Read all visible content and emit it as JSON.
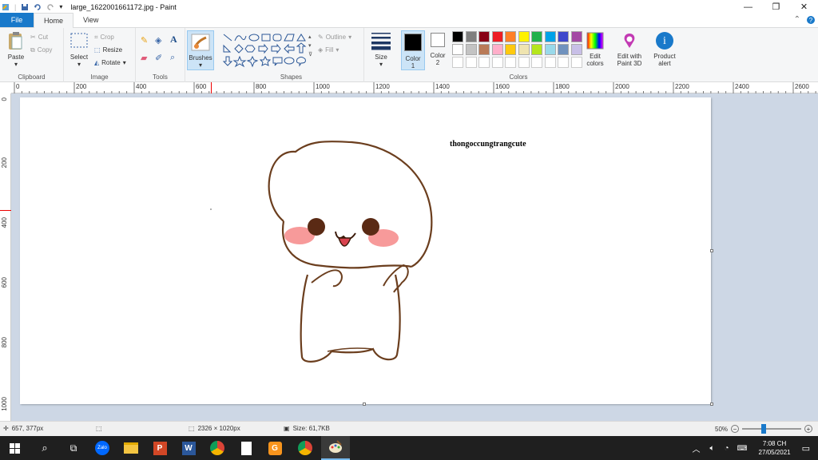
{
  "window": {
    "title": "large_1622001661172.jpg - Paint"
  },
  "tabs": [
    {
      "label": "File"
    },
    {
      "label": "Home"
    },
    {
      "label": "View"
    }
  ],
  "clipboard": {
    "paste": "Paste",
    "cut": "Cut",
    "copy": "Copy",
    "label": "Clipboard"
  },
  "image": {
    "select": "Select",
    "crop": "Crop",
    "resize": "Resize",
    "rotate": "Rotate",
    "label": "Image"
  },
  "tools": {
    "label": "Tools"
  },
  "brushes": {
    "label": "Brushes"
  },
  "shapes": {
    "outline": "Outline",
    "fill": "Fill",
    "label": "Shapes"
  },
  "size": {
    "label": "Size"
  },
  "color1": {
    "label": "Color",
    "num": "1",
    "value": "#000000"
  },
  "color2": {
    "label": "Color",
    "num": "2",
    "value": "#ffffff"
  },
  "colors": {
    "label": "Colors",
    "row1": [
      "#000000",
      "#7f7f7f",
      "#880015",
      "#ed1c24",
      "#ff7f27",
      "#fff200",
      "#22b14c",
      "#00a2e8",
      "#3f48cc",
      "#a349a4"
    ],
    "row2": [
      "#ffffff",
      "#c3c3c3",
      "#b97a57",
      "#ffaec9",
      "#ffc90e",
      "#efe4b0",
      "#b5e61d",
      "#99d9ea",
      "#7092be",
      "#c8bfe7"
    ]
  },
  "edit_colors": {
    "line1": "Edit",
    "line2": "colors"
  },
  "paint3d": {
    "line1": "Edit with",
    "line2": "Paint 3D"
  },
  "product_alert": {
    "line1": "Product",
    "line2": "alert"
  },
  "ruler_top": [
    "0",
    "200",
    "400",
    "600",
    "800",
    "1000",
    "1200",
    "1400",
    "1600",
    "1800",
    "2000",
    "2200",
    "2400",
    "2600"
  ],
  "ruler_left": [
    "0",
    "200",
    "400",
    "600",
    "800",
    "1000"
  ],
  "canvas": {
    "caption": "thongoccungtrangcute"
  },
  "status": {
    "cursor": "657, 377px",
    "dimensions": "2326 × 1020px",
    "size": "Size: 61,7KB",
    "zoom": "50%"
  },
  "taskbar": {
    "time": "7:08 CH",
    "date": "27/05/2021",
    "zalo": "Zalo"
  }
}
